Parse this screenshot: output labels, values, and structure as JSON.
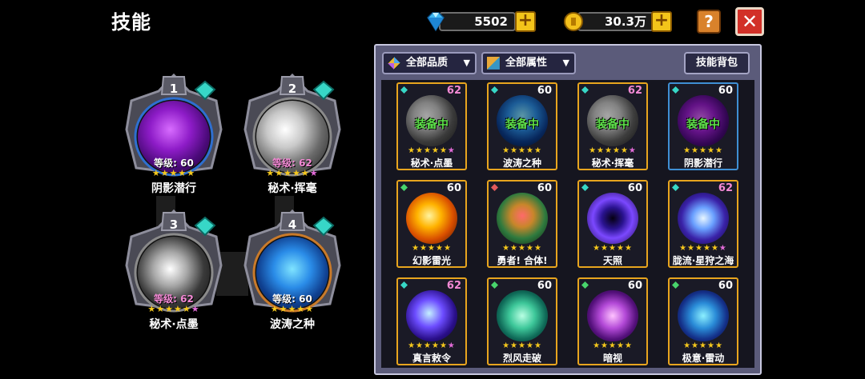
{
  "title": "技能",
  "currency": {
    "gems": "5502",
    "gold": "30.3万",
    "add_label": "+"
  },
  "buttons": {
    "help": "?",
    "close": "✕"
  },
  "slots": [
    {
      "number": "1",
      "level": "等级: 60",
      "name": "阴影潜行",
      "max_stars": "★★★★★",
      "extra_star": ""
    },
    {
      "number": "2",
      "level": "等级: 62",
      "name": "秘术·挥毫",
      "max_stars": "★★★★★",
      "extra_star": "★"
    },
    {
      "number": "3",
      "level": "等级: 62",
      "name": "秘术·点墨",
      "max_stars": "★★★★★",
      "extra_star": "★"
    },
    {
      "number": "4",
      "level": "等级: 60",
      "name": "波涛之种",
      "max_stars": "★★★★★",
      "extra_star": ""
    }
  ],
  "filters": {
    "quality": "全部品质",
    "attribute": "全部属性",
    "bag": "技能背包"
  },
  "equipped_label": "装备中",
  "skills": [
    {
      "name": "秘术·点墨",
      "level": "62",
      "equipped": true
    },
    {
      "name": "波涛之种",
      "level": "60",
      "equipped": true
    },
    {
      "name": "秘术·挥毫",
      "level": "62",
      "equipped": true
    },
    {
      "name": "阴影潜行",
      "level": "60",
      "equipped": true
    },
    {
      "name": "幻影雷光",
      "level": "60",
      "equipped": false
    },
    {
      "name": "勇者! 合体!",
      "level": "60",
      "equipped": false
    },
    {
      "name": "天照",
      "level": "60",
      "equipped": false
    },
    {
      "name": "胧流·星狩之海",
      "level": "62",
      "equipped": false
    },
    {
      "name": "真言敕令",
      "level": "62",
      "equipped": false
    },
    {
      "name": "烈风走破",
      "level": "60",
      "equipped": false
    },
    {
      "name": "暗视",
      "level": "60",
      "equipped": false
    },
    {
      "name": "极意·雷动",
      "level": "60",
      "equipped": false
    }
  ],
  "colors": {
    "gold_border": "#e8a51e",
    "blue_border": "#3f8fd4",
    "equipped_text": "#5fe14b",
    "level_62": "#f58ad6"
  }
}
